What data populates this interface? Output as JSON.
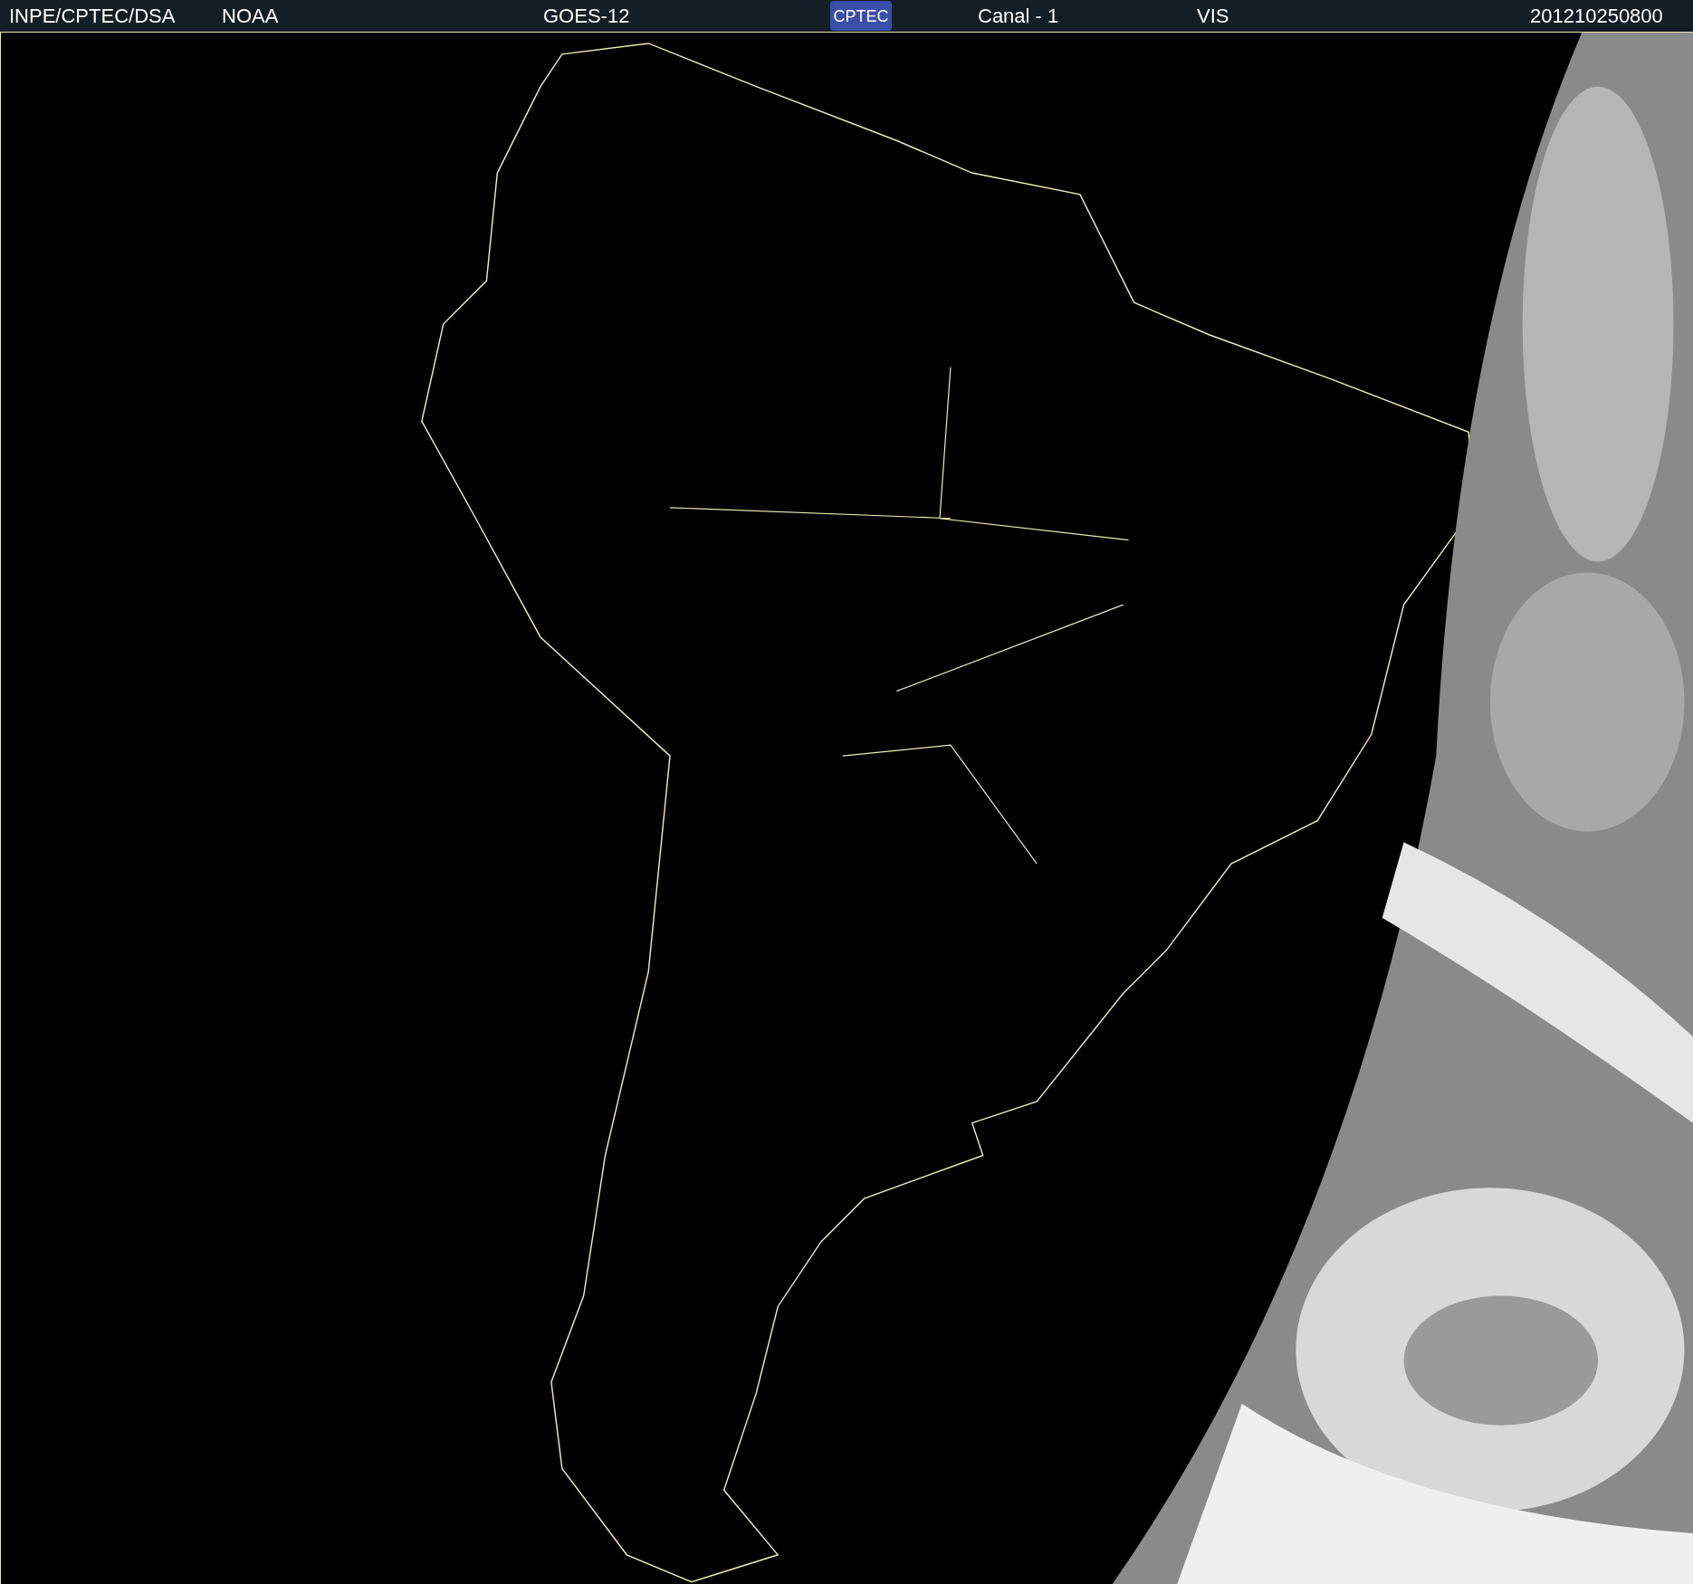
{
  "header": [
    {
      "kind": "text",
      "text": "INPE/CPTEC/DSA"
    },
    {
      "kind": "text",
      "text": "NOAA"
    },
    {
      "kind": "text",
      "text": "GOES-12"
    },
    {
      "kind": "logo",
      "text": "CPTEC"
    },
    {
      "kind": "text",
      "text": "Canal - 1"
    },
    {
      "kind": "text",
      "text": "VIS"
    },
    {
      "kind": "text",
      "text": "201210250800"
    }
  ]
}
